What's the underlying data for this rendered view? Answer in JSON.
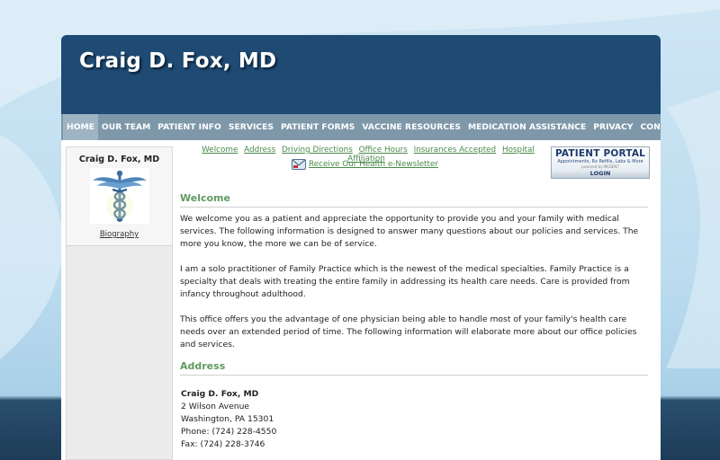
{
  "header": {
    "title": "Craig D. Fox, MD"
  },
  "nav": {
    "items": [
      {
        "label": "HOME",
        "name": "nav-home"
      },
      {
        "label": "OUR TEAM",
        "name": "nav-our-team"
      },
      {
        "label": "PATIENT INFO",
        "name": "nav-patient-info"
      },
      {
        "label": "SERVICES",
        "name": "nav-services"
      },
      {
        "label": "PATIENT FORMS",
        "name": "nav-patient-forms"
      },
      {
        "label": "VACCINE RESOURCES",
        "name": "nav-vaccine-resources"
      },
      {
        "label": "MEDICATION ASSISTANCE",
        "name": "nav-medication-assistance"
      },
      {
        "label": "PRIVACY",
        "name": "nav-privacy"
      },
      {
        "label": "CONTACT US",
        "name": "nav-contact-us"
      }
    ],
    "active": "HOME"
  },
  "sidebar": {
    "name": "Craig D. Fox, MD",
    "image_icon": "caduceus-icon",
    "bio_link": "Biography"
  },
  "quicklinks": [
    "Welcome",
    "Address",
    "Driving Directions",
    "Office Hours",
    "Insurances Accepted",
    "Hospital Affiliation"
  ],
  "newsletter": {
    "label": "Receive Our Health e-Newsletter",
    "icon": "newsletter-icon"
  },
  "portal": {
    "title": "PATIENT PORTAL",
    "subtitle": "Appointments, Rx Refills, Labs & More",
    "powered": "powered by MEDENT",
    "login": "LOGIN"
  },
  "welcome": {
    "heading": "Welcome",
    "paragraphs": [
      "We welcome you as a patient and appreciate the opportunity to provide you and your family with medical services.  The following information is designed to answer many questions about our policies and services.  The more you know, the more we can be of service.",
      "I am a solo practitioner of Family Practice which is the newest of the medical specialties.  Family Practice is a specialty that deals with treating the entire family in addressing its health care needs.  Care is provided from infancy throughout adulthood.",
      "This office offers you the advantage of one physician being able to handle most of your family's health care needs over an extended period of time.  The following information will elaborate more about our office policies and services."
    ]
  },
  "address": {
    "heading": "Address",
    "name": "Craig D. Fox, MD",
    "street": "2 Wilson Avenue",
    "city": "Washington, PA 15301",
    "phone": "Phone: (724) 228-4550",
    "fax": "Fax: (724) 228-3746"
  },
  "colors": {
    "header_bg": "#1e4a73",
    "nav_bg": "#7e98aa",
    "heading_green": "#5f9a5f",
    "link_green": "#4a8a4a"
  }
}
